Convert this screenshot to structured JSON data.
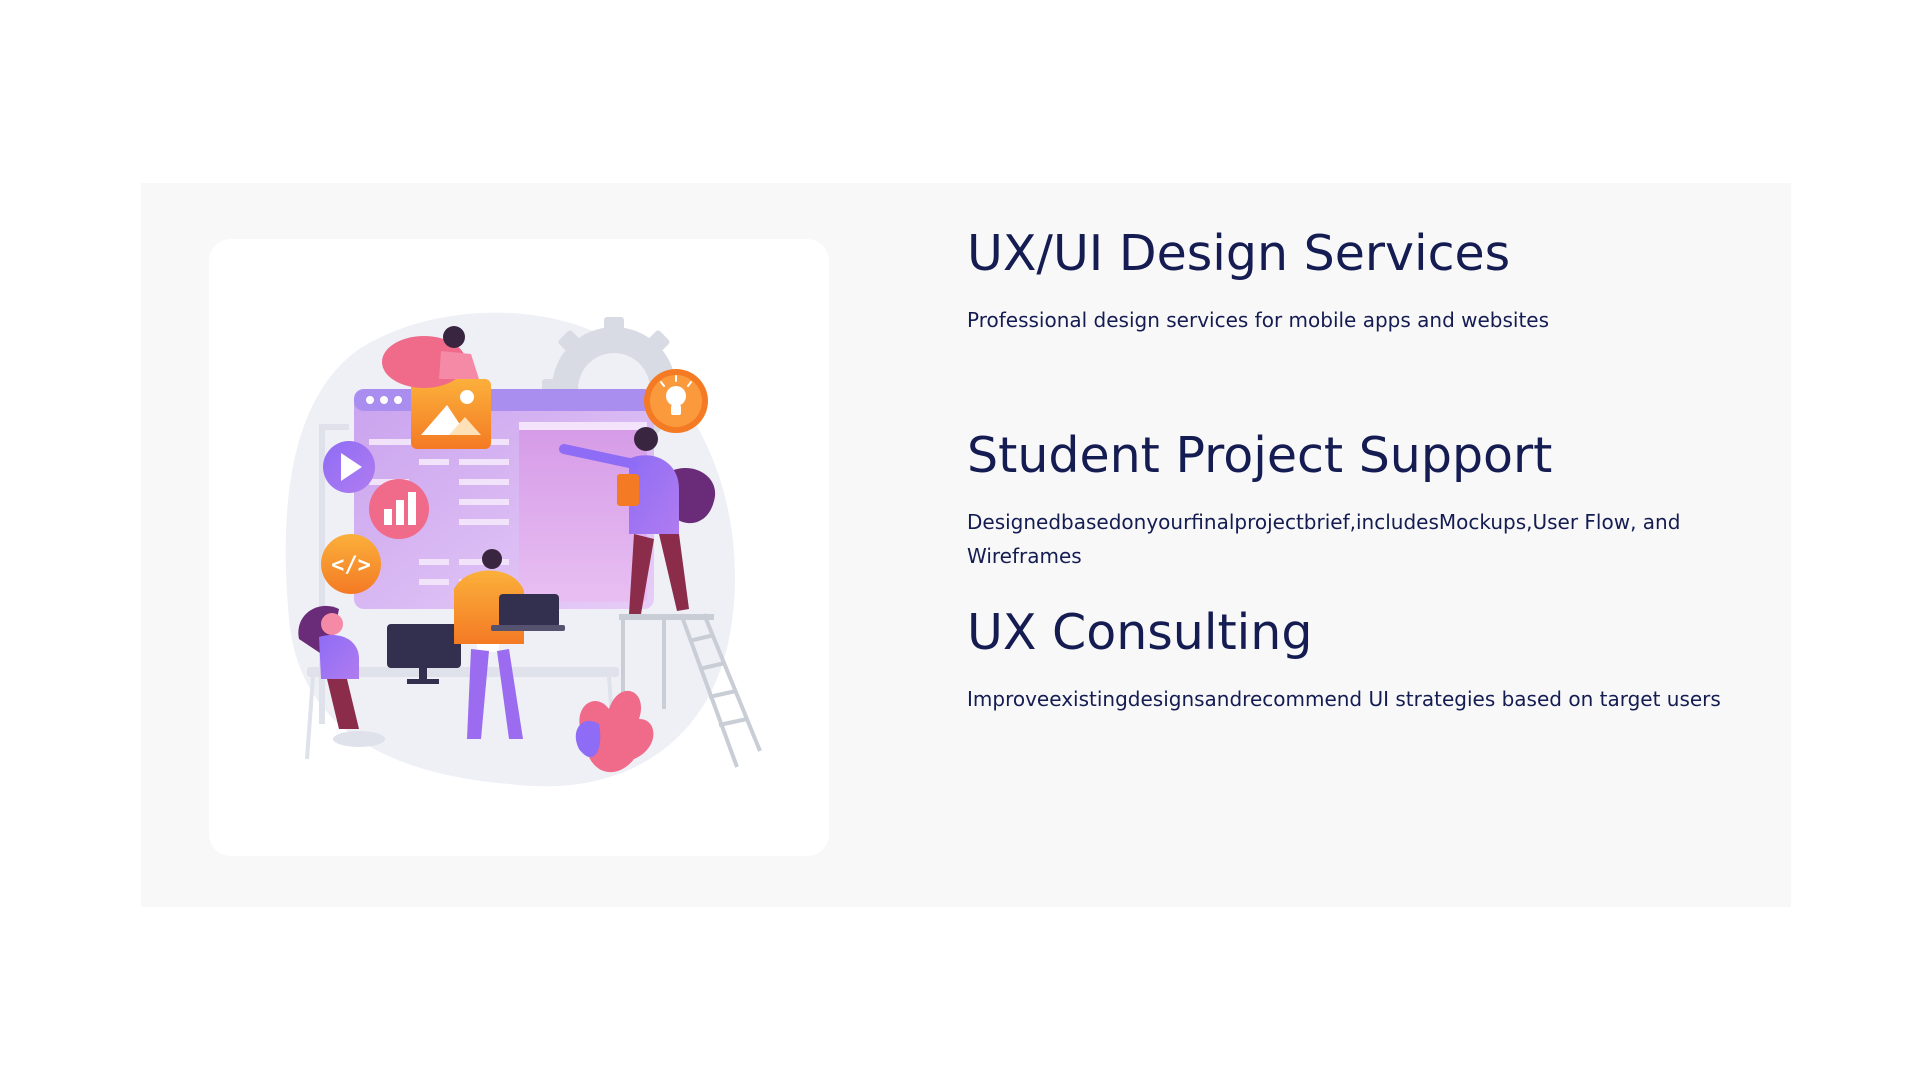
{
  "services": [
    {
      "title": "UX/UI Design Services",
      "description": "Professional design services for mobile apps and websites"
    },
    {
      "title": "Student Project Support",
      "description": "Designedbasedonyourfinalprojectbrief,includesMockups,User Flow, and Wireframes"
    },
    {
      "title": "UX Consulting",
      "description": "Improveexistingdesignsandrecommend UI strategies based on target users"
    }
  ],
  "illustration": {
    "icon_names": [
      "image-icon",
      "play-icon",
      "bar-chart-icon",
      "code-icon",
      "lightbulb-icon",
      "gear-icon"
    ],
    "code_glyph": "</>",
    "colors": {
      "heading": "#141c52",
      "section_bg": "#f8f8f8",
      "purple": "#9b6cf0",
      "orange": "#f8a23a",
      "pink": "#f06a8a",
      "blob": "#eef0f6"
    }
  }
}
